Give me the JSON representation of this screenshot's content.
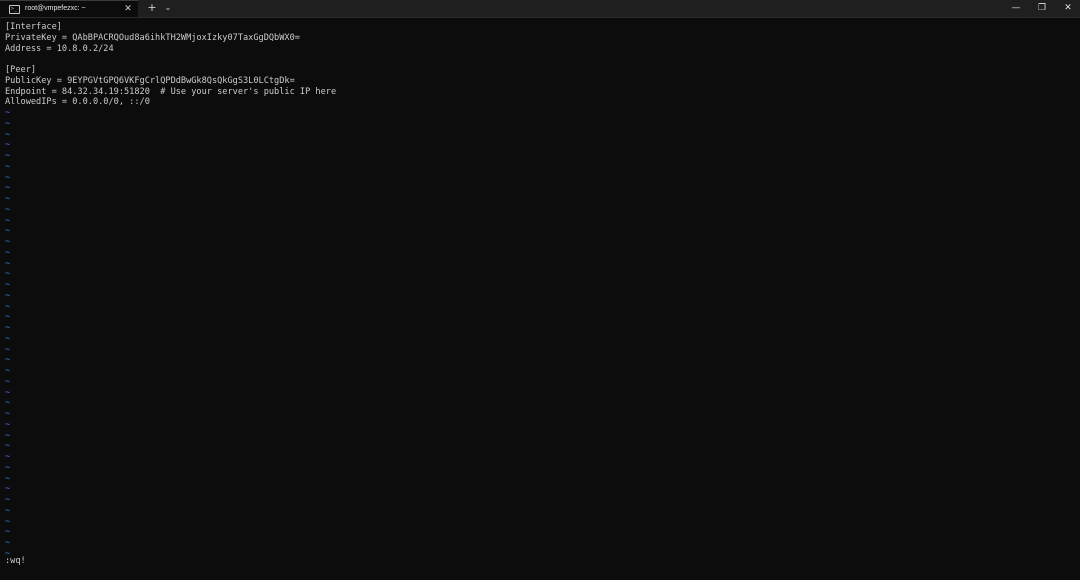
{
  "window": {
    "tab_title": "root@vmpefezxc: ~",
    "tab_close_glyph": "✕",
    "new_tab_glyph": "+",
    "dropdown_glyph": "⌄",
    "minimize_glyph": "—",
    "maximize_glyph": "❐",
    "close_glyph": "✕",
    "icon": "terminal-icon"
  },
  "editor": {
    "lines": [
      "[Interface]",
      "PrivateKey = QAbBPACRQOud8a6ihkTH2WMjoxIzky07TaxGgDQbWX0=",
      "Address = 10.8.0.2/24",
      "",
      "[Peer]",
      "PublicKey = 9EYPGVtGPQ6VKFgCrlQPDdBwGk8QsQkGgS3L0LCtgDk=",
      "Endpoint = 84.32.34.19:51820  # Use your server's public IP here",
      "AllowedIPs = 0.0.0.0/0, ::/0"
    ],
    "tilde_glyph": "~",
    "tilde_count": 42,
    "command": ":wq!"
  },
  "colors": {
    "background": "#0c0c0c",
    "text": "#cccccc",
    "tilde": "#3b78ff",
    "titlebar": "#1f1f1f"
  }
}
